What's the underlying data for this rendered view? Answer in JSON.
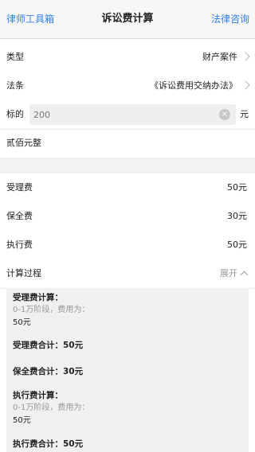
{
  "nav": {
    "left_label": "律师工具箱",
    "title": "诉讼费计算",
    "right_label": "法律咨询"
  },
  "form": {
    "type_label": "类型",
    "type_value": "财产案件",
    "law_label": "法条",
    "law_value": "《诉讼费用交纳办法》",
    "amount_label": "标的",
    "amount_placeholder": "200",
    "amount_unit": "元",
    "amount_in_words": "贰佰元整"
  },
  "fees": [
    {
      "label": "受理费",
      "value": "50元"
    },
    {
      "label": "保全费",
      "value": "30元"
    },
    {
      "label": "执行费",
      "value": "50元"
    }
  ],
  "process": {
    "label": "计算过程",
    "toggle_label": "展开",
    "steps": {
      "acceptance_title": "受理费计算：",
      "acceptance_rule": "0-1万阶段，费用为：",
      "acceptance_amount": "50元",
      "acceptance_total": "受理费合计：50元",
      "preservation_total": "保全费合计：30元",
      "execution_title": "执行费计算：",
      "execution_rule": "0-1万阶段，费用为：",
      "execution_amount": "50元",
      "execution_total": "执行费合计：50元"
    }
  }
}
